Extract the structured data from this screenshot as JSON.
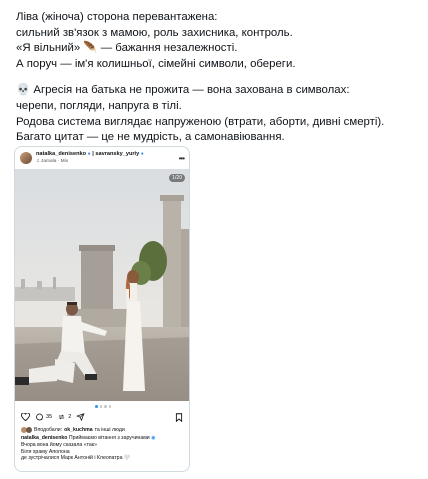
{
  "post": {
    "lines_p1": [
      "Ліва (жіноча) сторона перевантажена:",
      "сильний зв'язок з мамою, роль захисника, контроль.",
      "«Я вільний» 🪶 — бажання незалежності.",
      "А поруч — ім'я колишньої, сімейні символи, обереги."
    ],
    "lines_p2": [
      "💀 Агресія на батька не прожита — вона захована в символах:",
      "черепи, погляди, напруга в тілі.",
      "Родова система виглядає напруженою (втрати, аборти, дивні смерті).",
      "Багато цитат — це не мудрість, а самонавіювання."
    ]
  },
  "instagram": {
    "user1": "natalka_denisenko",
    "user2": "savransky_yuriy",
    "music": "♫ Jamala · Mix",
    "more_icon": "ellipsis-icon",
    "counter": "1/20",
    "likes_count": "35",
    "repost_count": "2",
    "liked_by_prefix": "Вподобали:",
    "liked_by_user": "ok_kuchma",
    "liked_by_suffix": "та інші люди",
    "caption_user": "natalka_denisenko",
    "caption_text": "Приймаємо вітання з заручинами",
    "caption_lines": [
      "Вчора вона йому сказала «так»",
      "Біля храму Аполона",
      "де зустрічалися Марк Антоній і Клеопатра 🤍"
    ],
    "colors": {
      "verified": "#2d8ef5",
      "dot_active": "#3897f0"
    }
  }
}
